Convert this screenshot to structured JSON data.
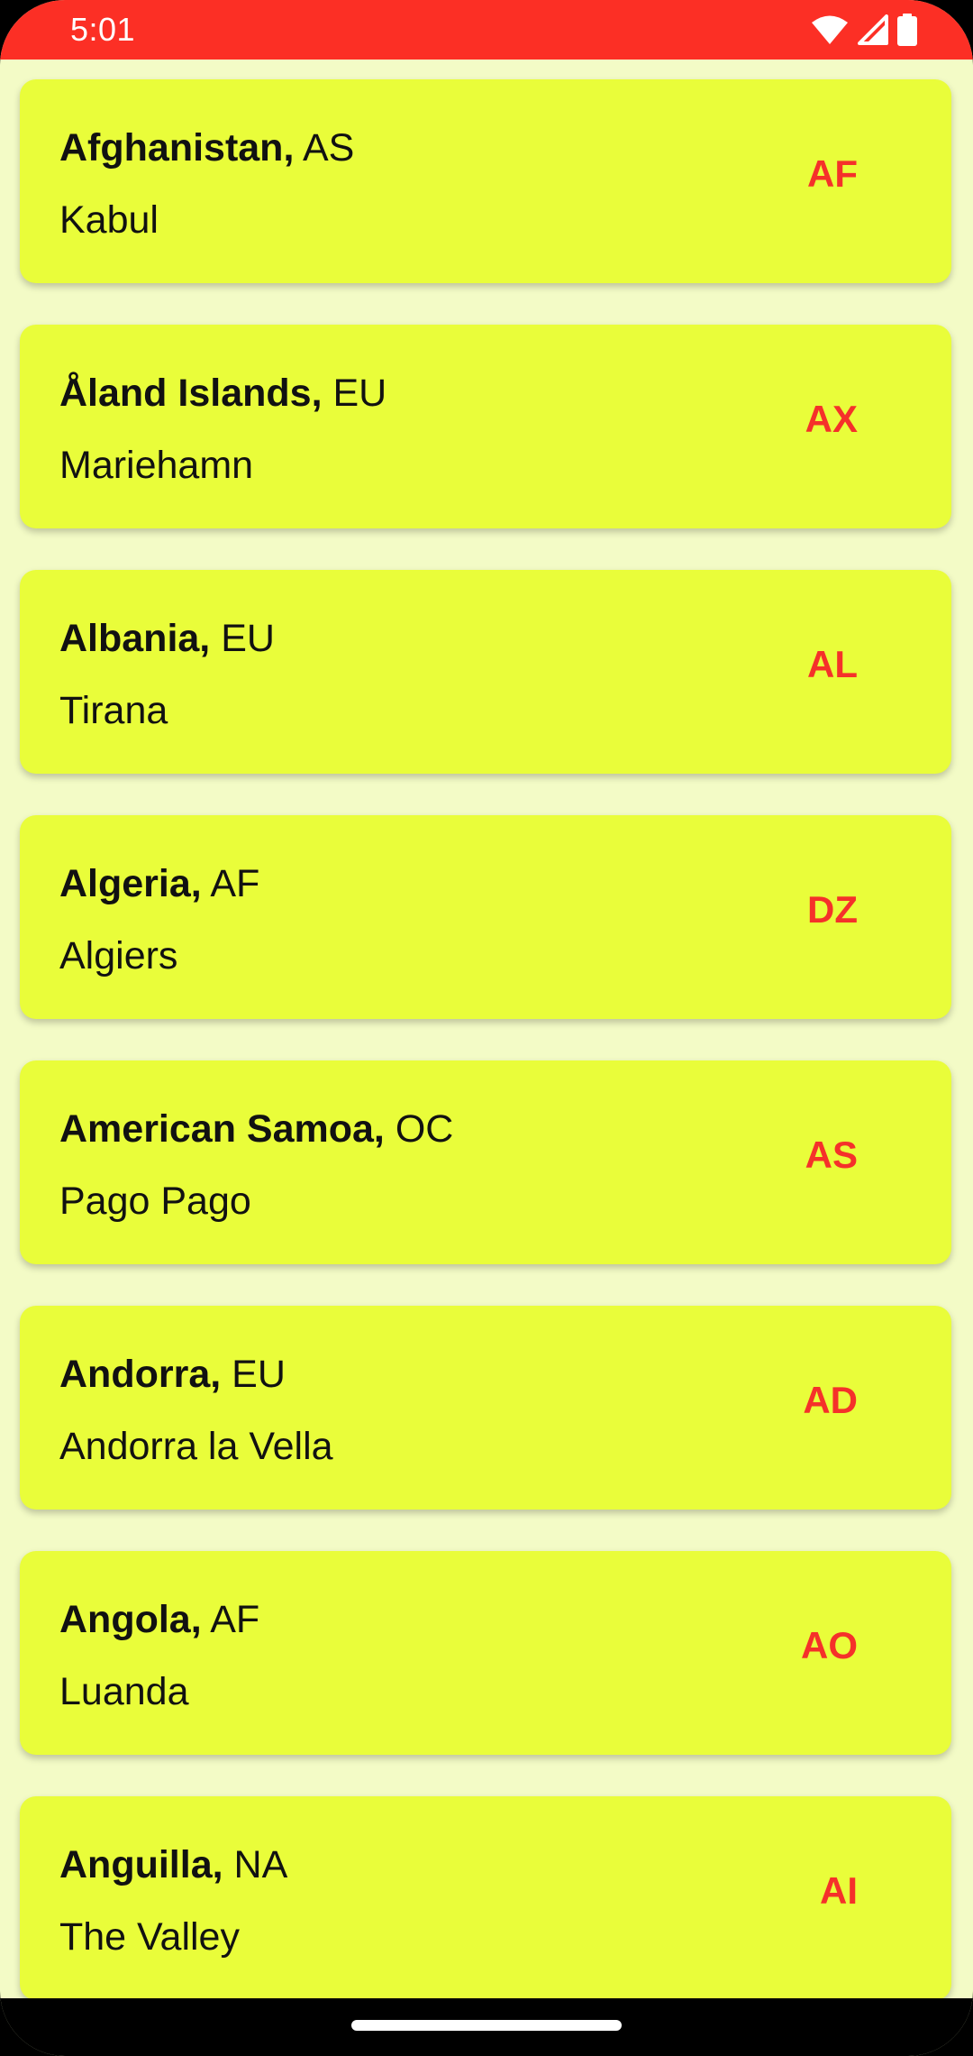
{
  "status_bar": {
    "time": "5:01",
    "icons": [
      "wifi-icon",
      "cell-signal-icon",
      "battery-icon"
    ],
    "background_color": "#fc2f25"
  },
  "colors": {
    "page_background": "#f3fbc6",
    "card_background": "#e9fd3a",
    "code_color": "#f5312a"
  },
  "countries": [
    {
      "name": "Afghanistan,",
      "continent": "AS",
      "capital": "Kabul",
      "code": "AF"
    },
    {
      "name": "Åland Islands,",
      "continent": "EU",
      "capital": "Mariehamn",
      "code": "AX"
    },
    {
      "name": "Albania,",
      "continent": "EU",
      "capital": "Tirana",
      "code": "AL"
    },
    {
      "name": "Algeria,",
      "continent": "AF",
      "capital": "Algiers",
      "code": "DZ"
    },
    {
      "name": "American Samoa,",
      "continent": "OC",
      "capital": "Pago Pago",
      "code": "AS"
    },
    {
      "name": "Andorra,",
      "continent": "EU",
      "capital": "Andorra la Vella",
      "code": "AD"
    },
    {
      "name": "Angola,",
      "continent": "AF",
      "capital": "Luanda",
      "code": "AO"
    },
    {
      "name": "Anguilla,",
      "continent": "NA",
      "capital": "The Valley",
      "code": "AI"
    }
  ]
}
